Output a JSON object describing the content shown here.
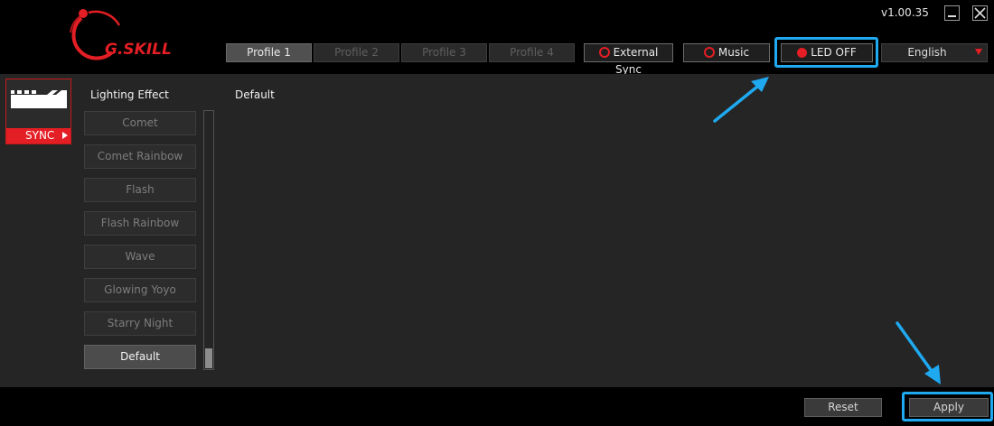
{
  "app": {
    "version": "v1.00.35"
  },
  "colors": {
    "accent": "#e31e24",
    "highlight": "#1fa9f0"
  },
  "profiles": [
    {
      "label": "Profile 1",
      "active": true
    },
    {
      "label": "Profile 2",
      "active": false
    },
    {
      "label": "Profile 3",
      "active": false
    },
    {
      "label": "Profile 4",
      "active": false
    }
  ],
  "toolbar": {
    "external_sync": "External Sync",
    "music": "Music",
    "led_off": "LED OFF",
    "language": "English"
  },
  "device": {
    "label": "SYNC",
    "icon": "ram-module-icon"
  },
  "lighting": {
    "heading": "Lighting Effect",
    "current": "Default",
    "effects": [
      "Comet",
      "Comet Rainbow",
      "Flash",
      "Flash Rainbow",
      "Wave",
      "Glowing Yoyo",
      "Starry Night",
      "Default"
    ],
    "selected": "Default"
  },
  "footer": {
    "reset": "Reset",
    "apply": "Apply"
  }
}
